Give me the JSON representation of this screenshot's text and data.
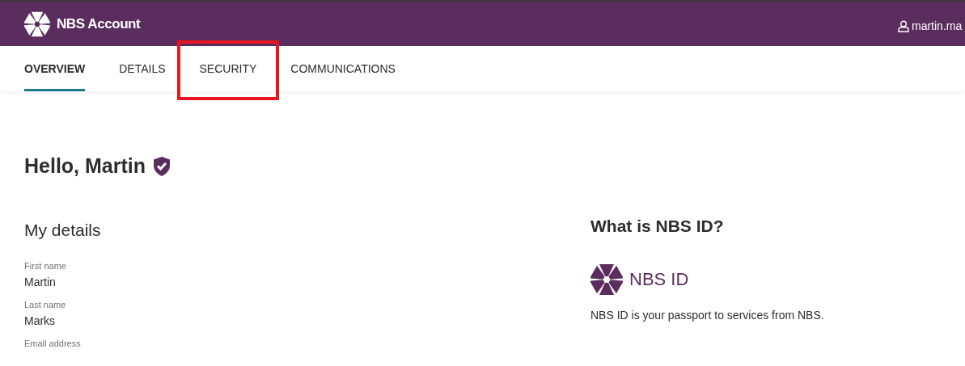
{
  "header": {
    "title": "NBS Account",
    "user": "martin.ma"
  },
  "tabs": [
    {
      "label": "OVERVIEW",
      "selected": true,
      "highlighted": false
    },
    {
      "label": "DETAILS",
      "selected": false,
      "highlighted": false
    },
    {
      "label": "SECURITY",
      "selected": false,
      "highlighted": true
    },
    {
      "label": "COMMUNICATIONS",
      "selected": false,
      "highlighted": false
    }
  ],
  "greeting": "Hello, Martin",
  "my_details": {
    "heading": "My details",
    "fields": [
      {
        "label": "First name",
        "value": "Martin"
      },
      {
        "label": "Last name",
        "value": "Marks"
      },
      {
        "label": "Email address"
      }
    ]
  },
  "nbs_id": {
    "heading": "What is NBS ID?",
    "logo_text": "NBS ID",
    "description": "NBS ID is your passport to services from NBS."
  }
}
